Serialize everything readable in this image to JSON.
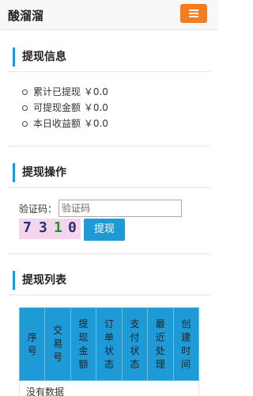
{
  "header": {
    "brand": "酸溜溜",
    "menu_icon": "hamburger-menu-icon",
    "menu_color": "#f57c1f"
  },
  "accent_color": "#1e9bd7",
  "withdraw_info": {
    "title": "提现信息",
    "items": [
      "累计已提现 ￥0.0",
      "可提现金额 ￥0.0",
      "本日收益额 ￥0.0"
    ]
  },
  "withdraw_action": {
    "title": "提现操作",
    "captcha_label": "验证码：",
    "captcha_placeholder": "验证码",
    "captcha_digits": [
      "7",
      "3",
      "1",
      "0"
    ],
    "submit_label": "提现"
  },
  "withdraw_list": {
    "title": "提现列表",
    "columns": [
      "序号",
      "交易号",
      "提现金额",
      "订单状态",
      "支付状态",
      "最近处理",
      "创建时间"
    ],
    "empty_text": "没有数据"
  }
}
